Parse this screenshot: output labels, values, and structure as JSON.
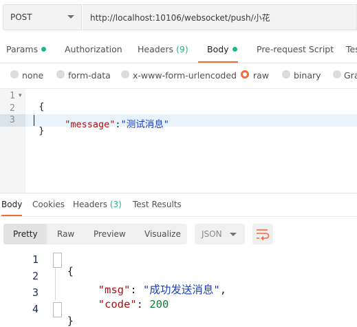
{
  "request": {
    "method": "POST",
    "url": "http://localhost:10106/websocket/push/小花"
  },
  "tabs": [
    {
      "label": "Params",
      "dot": true
    },
    {
      "label": "Authorization"
    },
    {
      "label": "Headers",
      "count": "(9)"
    },
    {
      "label": "Body",
      "dot": true,
      "active": true
    },
    {
      "label": "Pre-request Script"
    },
    {
      "label": "Tes"
    }
  ],
  "body_types": [
    {
      "label": "none"
    },
    {
      "label": "form-data"
    },
    {
      "label": "x-www-form-urlencoded"
    },
    {
      "label": "raw",
      "selected": true
    },
    {
      "label": "binary"
    },
    {
      "label": "Gra"
    }
  ],
  "request_editor": {
    "line_numbers": [
      "1",
      "2",
      "3"
    ],
    "line1": "{",
    "key": "\"message\"",
    "colon": ":",
    "value": "\"测试消息\"",
    "line3": "}"
  },
  "response_tabs": [
    {
      "label": "Body",
      "active": true
    },
    {
      "label": "Cookies"
    },
    {
      "label": "Headers",
      "count": "(3)"
    },
    {
      "label": "Test Results"
    }
  ],
  "view_modes": [
    "Pretty",
    "Raw",
    "Preview",
    "Visualize"
  ],
  "format": "JSON",
  "response_body": {
    "line_numbers": [
      "1",
      "2",
      "3",
      "4"
    ],
    "open": "{",
    "msg_key": "\"msg\"",
    "msg_value": "\"成功发送消息\"",
    "code_key": "\"code\"",
    "code_value": "200",
    "close": "}"
  },
  "colors": {
    "accent": "#f26b3a",
    "green": "#26b47f",
    "key": "#a11",
    "string": "#1a3fb5",
    "number": "#117a3b"
  }
}
